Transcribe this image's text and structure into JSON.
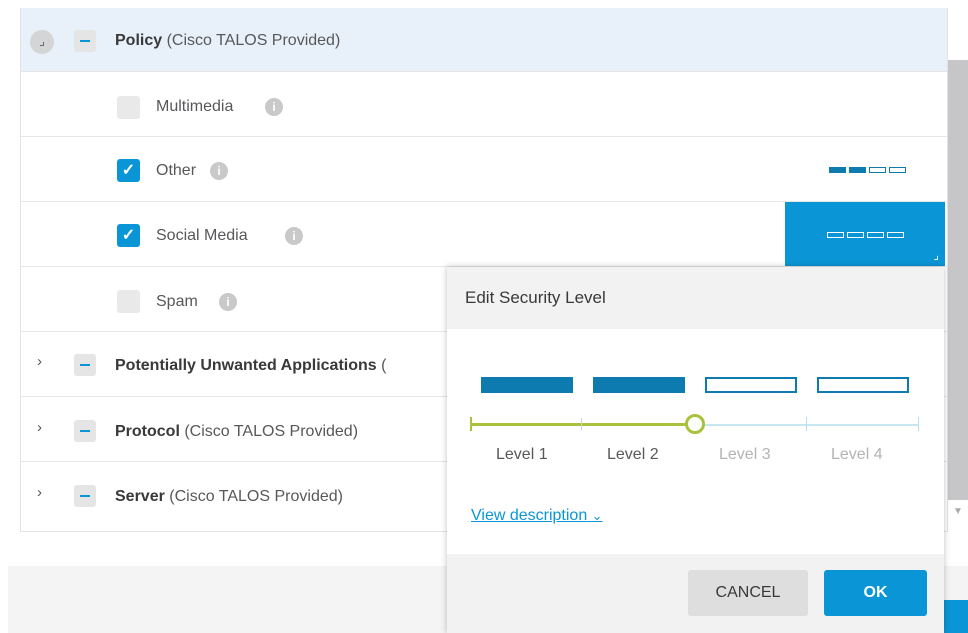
{
  "rows": {
    "policy": {
      "title": "Policy",
      "suffix": "(Cisco TALOS Provided)"
    },
    "multimedia": {
      "label": "Multimedia"
    },
    "other": {
      "label": "Other"
    },
    "social": {
      "label": "Social Media"
    },
    "spam": {
      "label": "Spam"
    },
    "pua": {
      "title": "Potentially Unwanted Applications",
      "suffix": "("
    },
    "protocol": {
      "title": "Protocol",
      "suffix": "(Cisco TALOS Provided)"
    },
    "server": {
      "title": "Server",
      "suffix": "(Cisco TALOS Provided)"
    }
  },
  "popup": {
    "title": "Edit Security Level",
    "levels": [
      "Level 1",
      "Level 2",
      "Level 3",
      "Level 4"
    ],
    "current_level": 2,
    "view_description": "View description",
    "cancel": "CANCEL",
    "ok": "OK"
  },
  "glyphs": {
    "info": "i",
    "check": "✓",
    "chevron_right": "›",
    "chevron_down": "⌄",
    "collapse": "⌟"
  },
  "colors": {
    "accent": "#0a96d6",
    "level_bar": "#0e7bb0",
    "slider": "#a9c23c",
    "header_bg": "#e8f1f9"
  }
}
